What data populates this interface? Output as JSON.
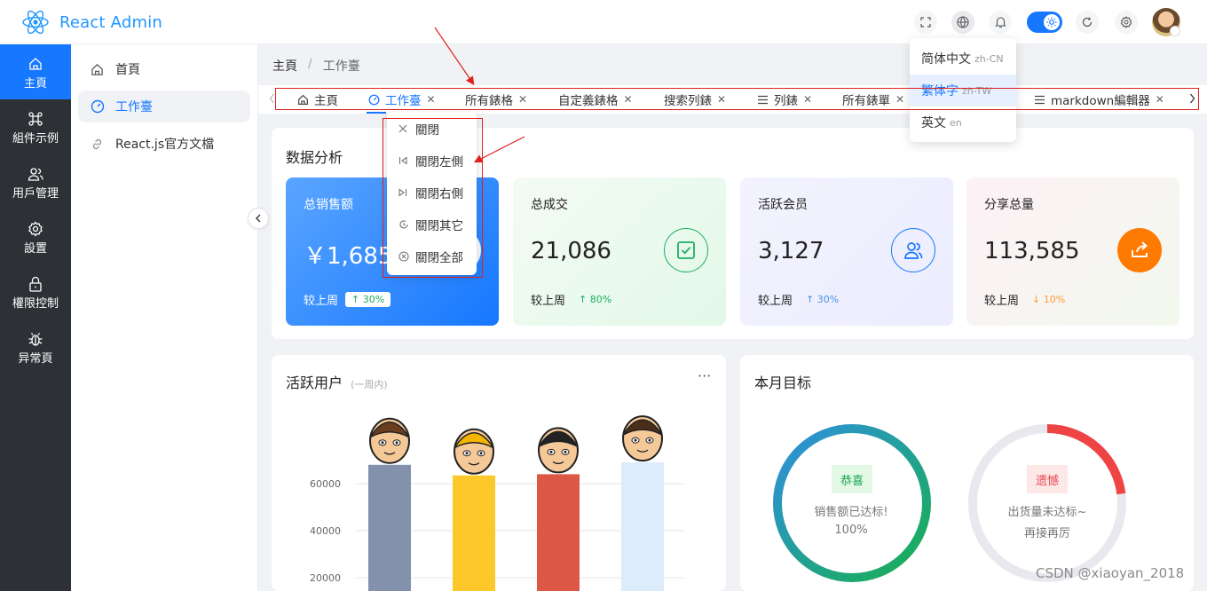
{
  "app": {
    "title": "React Admin"
  },
  "header": {
    "icons": [
      "fullscreen-icon",
      "globe-icon",
      "bell-icon",
      "theme-toggle",
      "refresh-icon",
      "settings-icon",
      "avatar"
    ]
  },
  "sidenav": {
    "items": [
      {
        "label": "主頁",
        "icon": "home-icon",
        "active": true
      },
      {
        "label": "組件示例",
        "icon": "command-icon"
      },
      {
        "label": "用戶管理",
        "icon": "users-icon"
      },
      {
        "label": "設置",
        "icon": "gear-icon"
      },
      {
        "label": "權限控制",
        "icon": "lock-icon"
      },
      {
        "label": "异常頁",
        "icon": "bug-icon"
      }
    ]
  },
  "submenu": {
    "items": [
      {
        "label": "首頁",
        "icon": "home-icon"
      },
      {
        "label": "工作臺",
        "icon": "dashboard-icon",
        "active": true
      },
      {
        "label": "React.js官方文檔",
        "icon": "link-icon"
      }
    ]
  },
  "breadcrumb": {
    "root": "主頁",
    "separator": "/",
    "current": "工作臺"
  },
  "tabs": [
    {
      "label": "主頁",
      "icon": "home-icon"
    },
    {
      "label": "工作臺",
      "icon": "dashboard-icon",
      "active": true
    },
    {
      "label": "所有錶格"
    },
    {
      "label": "自定義錶格"
    },
    {
      "label": "搜索列錶"
    },
    {
      "label": "列錶",
      "icon": "list-icon"
    },
    {
      "label": "所有錶單"
    },
    {
      "label": "markdown編輯器",
      "icon": "list-icon"
    }
  ],
  "context_menu": {
    "items": [
      {
        "label": "關閉",
        "icon": "close-icon"
      },
      {
        "label": "關閉左側",
        "icon": "close-left-icon"
      },
      {
        "label": "關閉右側",
        "icon": "close-right-icon"
      },
      {
        "label": "關閉其它",
        "icon": "close-other-icon"
      },
      {
        "label": "關閉全部",
        "icon": "close-all-icon"
      }
    ]
  },
  "language_menu": {
    "items": [
      {
        "label": "简体中文",
        "code": "zh-CN"
      },
      {
        "label": "繁体字",
        "code": "zh-TW",
        "selected": true
      },
      {
        "label": "英文",
        "code": "en"
      }
    ]
  },
  "analysis": {
    "title": "数据分析",
    "compare_label": "较上周",
    "stats": [
      {
        "label": "总销售额",
        "value": "￥1,685",
        "change": "30%",
        "direction": "up"
      },
      {
        "label": "总成交",
        "value": "21,086",
        "change": "80%",
        "direction": "up"
      },
      {
        "label": "活跃会员",
        "value": "3,127",
        "change": "30%",
        "direction": "up"
      },
      {
        "label": "分享总量",
        "value": "113,585",
        "change": "10%",
        "direction": "down"
      }
    ]
  },
  "active_users": {
    "title": "活跃用户",
    "subtitle": "(一周内)",
    "more": "···",
    "chart_data": {
      "type": "bar",
      "categories": [
        "",
        "",
        "",
        ""
      ],
      "values": [
        68000,
        63500,
        64000,
        69000
      ],
      "y_ticks": [
        20000,
        40000,
        60000
      ],
      "ylim": [
        0,
        80000
      ],
      "colors": [
        "#8391ad",
        "#fcc82a",
        "#dd5746",
        "#dcecfb"
      ]
    }
  },
  "monthly_goal": {
    "title": "本月目标",
    "rings": [
      {
        "tag": "恭喜",
        "line1": "销售额已达标!",
        "line2": "100%",
        "progress": 1.0
      },
      {
        "tag": "遗憾",
        "line1": "出货量未达标~",
        "line2": "再接再厉",
        "progress": 0.23
      }
    ]
  },
  "watermark": "CSDN @xiaoyan_2018",
  "colors": {
    "accent": "#1677ff",
    "sidenav_bg": "#2d3035",
    "annotation_red": "#e0201c"
  }
}
